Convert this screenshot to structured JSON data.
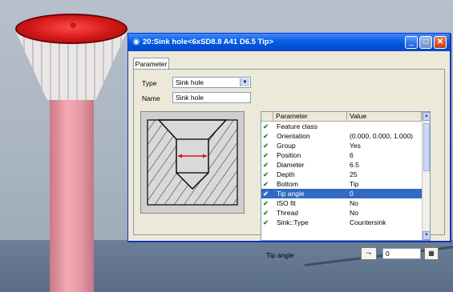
{
  "dialog": {
    "title": "20:Sink hole<6xSD8.8 A41 D6.5 Tip>",
    "tab": "Parameter",
    "type_label": "Type",
    "type_value": "Sink hole",
    "name_label": "Name",
    "name_value": "Sink hole",
    "grid": {
      "headers": [
        "Parameter",
        "Value"
      ],
      "rows": [
        {
          "param": "Feature class",
          "value": ""
        },
        {
          "param": "Orientation",
          "value": "(0.000, 0.000, 1.000)"
        },
        {
          "param": "Group",
          "value": "Yes"
        },
        {
          "param": "Position",
          "value": "6"
        },
        {
          "param": "Diameter",
          "value": "6.5"
        },
        {
          "param": "Depth",
          "value": "25"
        },
        {
          "param": "Bottom",
          "value": "Tip"
        },
        {
          "param": "Tip angle",
          "value": "0"
        },
        {
          "param": "ISO fit",
          "value": "No"
        },
        {
          "param": "Thread",
          "value": "No"
        },
        {
          "param": "Sink::Type",
          "value": "Countersink"
        }
      ]
    },
    "bottom_label": "Tip angle",
    "bottom_value": "0"
  },
  "colors": {
    "accent": "#316ac5",
    "titlebar": "#0a5ee8",
    "model": "#e79aa6",
    "rim": "#d01616"
  }
}
